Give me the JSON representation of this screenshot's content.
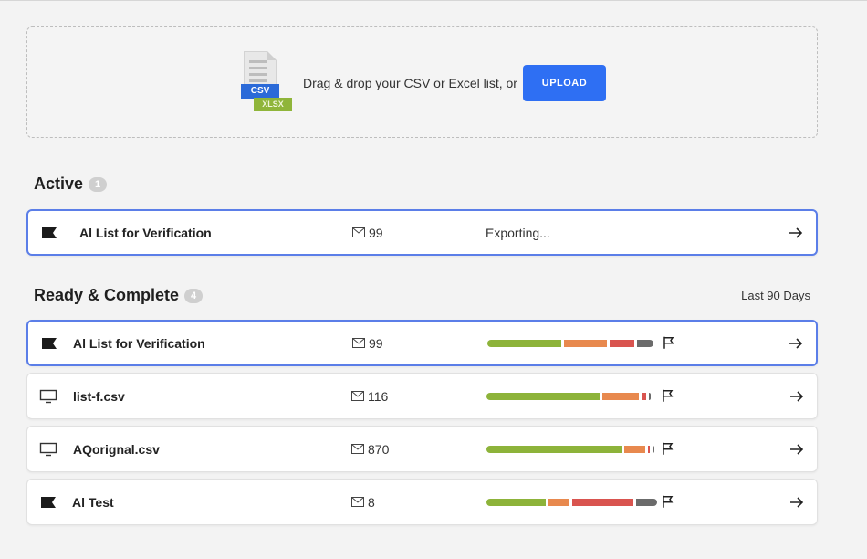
{
  "upload": {
    "csv_label": "CSV",
    "xlsx_label": "XLSX",
    "prompt": "Drag & drop your CSV or Excel list, or",
    "button_label": "UPLOAD"
  },
  "active": {
    "title": "Active",
    "count": "1",
    "rows": [
      {
        "icon": "flag-filled-icon",
        "name": "Al List for Verification",
        "count": "99",
        "status": "Exporting..."
      }
    ]
  },
  "complete": {
    "title": "Ready & Complete",
    "count": "4",
    "range_label": "Last 90 Days",
    "rows": [
      {
        "icon": "flag-filled-icon",
        "name": "Al List for Verification",
        "count": "99",
        "segments": [
          {
            "color": "#8db33a",
            "value": 0.45
          },
          {
            "color": "#e8894e",
            "value": 0.26
          },
          {
            "color": "#d9544f",
            "value": 0.15
          },
          {
            "color": "#6b6b6b",
            "value": 0.1
          }
        ]
      },
      {
        "icon": "monitor-icon",
        "name": "list-f.csv",
        "count": "116",
        "segments": [
          {
            "color": "#8db33a",
            "value": 0.69
          },
          {
            "color": "#e8894e",
            "value": 0.22
          },
          {
            "color": "#d9544f",
            "value": 0.03
          },
          {
            "color": "#6b6b6b",
            "value": 0.01
          }
        ]
      },
      {
        "icon": "monitor-icon",
        "name": "AQorignal.csv",
        "count": "870",
        "segments": [
          {
            "color": "#8db33a",
            "value": 0.82
          },
          {
            "color": "#e8894e",
            "value": 0.13
          },
          {
            "color": "#d9544f",
            "value": 0.01
          },
          {
            "color": "#6b6b6b",
            "value": 0.01
          }
        ]
      },
      {
        "icon": "flag-filled-icon",
        "name": "Al Test",
        "count": "8",
        "segments": [
          {
            "color": "#8db33a",
            "value": 0.36
          },
          {
            "color": "#e8894e",
            "value": 0.13
          },
          {
            "color": "#d9544f",
            "value": 0.37
          },
          {
            "color": "#6b6b6b",
            "value": 0.13
          }
        ]
      }
    ]
  }
}
